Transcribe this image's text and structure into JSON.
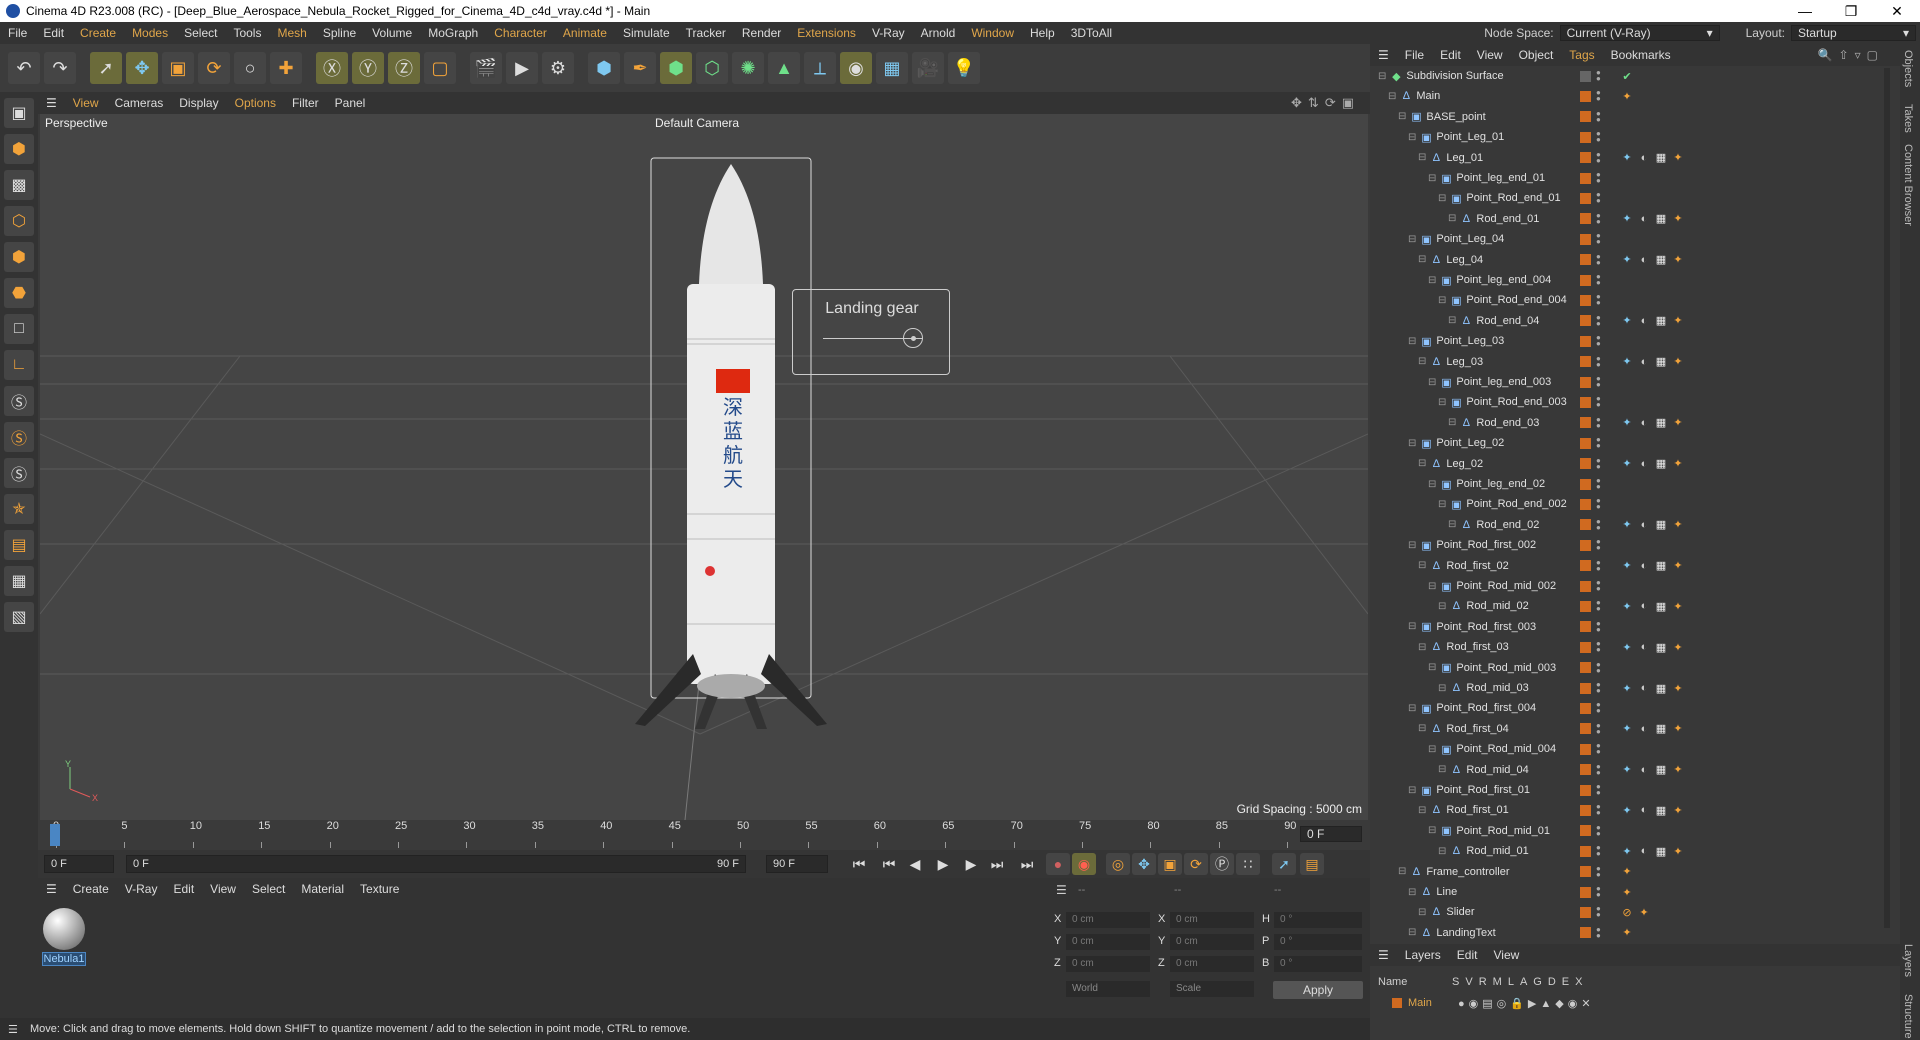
{
  "window": {
    "title": "Cinema 4D R23.008 (RC) - [Deep_Blue_Aerospace_Nebula_Rocket_Rigged_for_Cinema_4D_c4d_vray.c4d *] - Main",
    "minimize": "—",
    "maximize": "❐",
    "close": "✕"
  },
  "menu": {
    "items": [
      "File",
      "Edit",
      "Create",
      "Modes",
      "Select",
      "Tools",
      "Mesh",
      "Spline",
      "Volume",
      "MoGraph",
      "Character",
      "Animate",
      "Simulate",
      "Tracker",
      "Render",
      "Extensions",
      "V-Ray",
      "Arnold",
      "Window",
      "Help",
      "3DToAll"
    ],
    "node_space_label": "Node Space:",
    "node_space_value": "Current (V-Ray)",
    "layout_label": "Layout:",
    "layout_value": "Startup"
  },
  "viewport": {
    "menu": [
      "View",
      "Cameras",
      "Display",
      "Options",
      "Filter",
      "Panel"
    ],
    "label": "Perspective",
    "camera": "Default Camera",
    "grid_spacing": "Grid Spacing : 5000 cm",
    "overlay_title": "Landing gear",
    "overlay_slider_value": 0.9
  },
  "timeline": {
    "ticks": [
      "0",
      "5",
      "10",
      "15",
      "20",
      "25",
      "30",
      "35",
      "40",
      "45",
      "50",
      "55",
      "60",
      "65",
      "70",
      "75",
      "80",
      "85",
      "90"
    ],
    "current_frame": "0 F",
    "start_field": "0 F",
    "range_start": "0 F",
    "range_end": "90 F",
    "end_field": "90 F"
  },
  "material": {
    "menu": [
      "Create",
      "V-Ray",
      "Edit",
      "View",
      "Select",
      "Material",
      "Texture"
    ],
    "name": "Nebula1"
  },
  "coords": {
    "header": [
      "--",
      "--",
      "--"
    ],
    "rows": [
      {
        "a": "X",
        "av": "0 cm",
        "b": "X",
        "bv": "0 cm",
        "c": "H",
        "cv": "0 °"
      },
      {
        "a": "Y",
        "av": "0 cm",
        "b": "Y",
        "bv": "0 cm",
        "c": "P",
        "cv": "0 °"
      },
      {
        "a": "Z",
        "av": "0 cm",
        "b": "Z",
        "bv": "0 cm",
        "c": "B",
        "cv": "0 °"
      }
    ],
    "mode1": "World",
    "mode2": "Scale",
    "apply": "Apply"
  },
  "status": "Move: Click and drag to move elements. Hold down SHIFT to quantize movement / add to the selection in point mode, CTRL to remove.",
  "objects": {
    "menu": [
      "File",
      "Edit",
      "View",
      "Object",
      "Tags",
      "Bookmarks"
    ],
    "rows": [
      {
        "name": "Subdivision Surface",
        "depth": 0,
        "icon": "subdiv-icon",
        "tags": "check"
      },
      {
        "name": "Main",
        "depth": 1,
        "icon": "joint-icon",
        "tags": "rig"
      },
      {
        "name": "BASE_point",
        "depth": 2,
        "icon": "null-icon",
        "tags": ""
      },
      {
        "name": "Point_Leg_01",
        "depth": 3,
        "icon": "null-icon",
        "tags": ""
      },
      {
        "name": "Leg_01",
        "depth": 4,
        "icon": "joint-icon",
        "tags": "full"
      },
      {
        "name": "Point_leg_end_01",
        "depth": 5,
        "icon": "null-icon",
        "tags": ""
      },
      {
        "name": "Point_Rod_end_01",
        "depth": 6,
        "icon": "null-icon",
        "tags": ""
      },
      {
        "name": "Rod_end_01",
        "depth": 7,
        "icon": "joint-icon",
        "tags": "full"
      },
      {
        "name": "Point_Leg_04",
        "depth": 3,
        "icon": "null-icon",
        "tags": ""
      },
      {
        "name": "Leg_04",
        "depth": 4,
        "icon": "joint-icon",
        "tags": "full"
      },
      {
        "name": "Point_leg_end_004",
        "depth": 5,
        "icon": "null-icon",
        "tags": ""
      },
      {
        "name": "Point_Rod_end_004",
        "depth": 6,
        "icon": "null-icon",
        "tags": ""
      },
      {
        "name": "Rod_end_04",
        "depth": 7,
        "icon": "joint-icon",
        "tags": "full"
      },
      {
        "name": "Point_Leg_03",
        "depth": 3,
        "icon": "null-icon",
        "tags": ""
      },
      {
        "name": "Leg_03",
        "depth": 4,
        "icon": "joint-icon",
        "tags": "full"
      },
      {
        "name": "Point_leg_end_003",
        "depth": 5,
        "icon": "null-icon",
        "tags": ""
      },
      {
        "name": "Point_Rod_end_003",
        "depth": 6,
        "icon": "null-icon",
        "tags": ""
      },
      {
        "name": "Rod_end_03",
        "depth": 7,
        "icon": "joint-icon",
        "tags": "full"
      },
      {
        "name": "Point_Leg_02",
        "depth": 3,
        "icon": "null-icon",
        "tags": ""
      },
      {
        "name": "Leg_02",
        "depth": 4,
        "icon": "joint-icon",
        "tags": "full"
      },
      {
        "name": "Point_leg_end_02",
        "depth": 5,
        "icon": "null-icon",
        "tags": ""
      },
      {
        "name": "Point_Rod_end_002",
        "depth": 6,
        "icon": "null-icon",
        "tags": ""
      },
      {
        "name": "Rod_end_02",
        "depth": 7,
        "icon": "joint-icon",
        "tags": "full"
      },
      {
        "name": "Point_Rod_first_002",
        "depth": 3,
        "icon": "null-icon",
        "tags": ""
      },
      {
        "name": "Rod_first_02",
        "depth": 4,
        "icon": "joint-icon",
        "tags": "full"
      },
      {
        "name": "Point_Rod_mid_002",
        "depth": 5,
        "icon": "null-icon",
        "tags": ""
      },
      {
        "name": "Rod_mid_02",
        "depth": 6,
        "icon": "joint-icon",
        "tags": "full"
      },
      {
        "name": "Point_Rod_first_003",
        "depth": 3,
        "icon": "null-icon",
        "tags": ""
      },
      {
        "name": "Rod_first_03",
        "depth": 4,
        "icon": "joint-icon",
        "tags": "full"
      },
      {
        "name": "Point_Rod_mid_003",
        "depth": 5,
        "icon": "null-icon",
        "tags": ""
      },
      {
        "name": "Rod_mid_03",
        "depth": 6,
        "icon": "joint-icon",
        "tags": "full"
      },
      {
        "name": "Point_Rod_first_004",
        "depth": 3,
        "icon": "null-icon",
        "tags": ""
      },
      {
        "name": "Rod_first_04",
        "depth": 4,
        "icon": "joint-icon",
        "tags": "full"
      },
      {
        "name": "Point_Rod_mid_004",
        "depth": 5,
        "icon": "null-icon",
        "tags": ""
      },
      {
        "name": "Rod_mid_04",
        "depth": 6,
        "icon": "joint-icon",
        "tags": "full"
      },
      {
        "name": "Point_Rod_first_01",
        "depth": 3,
        "icon": "null-icon",
        "tags": ""
      },
      {
        "name": "Rod_first_01",
        "depth": 4,
        "icon": "joint-icon",
        "tags": "full"
      },
      {
        "name": "Point_Rod_mid_01",
        "depth": 5,
        "icon": "null-icon",
        "tags": ""
      },
      {
        "name": "Rod_mid_01",
        "depth": 6,
        "icon": "joint-icon",
        "tags": "full"
      },
      {
        "name": "Frame_controller",
        "depth": 2,
        "icon": "joint-icon",
        "tags": "rig"
      },
      {
        "name": "Line",
        "depth": 3,
        "icon": "joint-icon",
        "tags": "rig"
      },
      {
        "name": "Slider",
        "depth": 4,
        "icon": "joint-icon",
        "tags": "slider"
      },
      {
        "name": "LandingText",
        "depth": 3,
        "icon": "joint-icon",
        "tags": "rig"
      }
    ]
  },
  "layers": {
    "menu": [
      "Layers",
      "Edit",
      "View"
    ],
    "header_name": "Name",
    "header_cols": [
      "S",
      "V",
      "R",
      "M",
      "L",
      "A",
      "G",
      "D",
      "E",
      "X"
    ],
    "layer_name": "Main",
    "layer_color": "#d06a20"
  },
  "side_tabs": [
    "Objects",
    "Takes",
    "Content Browser",
    "Layers",
    "Structure"
  ],
  "colors": {
    "accent": "#e0a64a",
    "object_tag": "#d06a20"
  }
}
